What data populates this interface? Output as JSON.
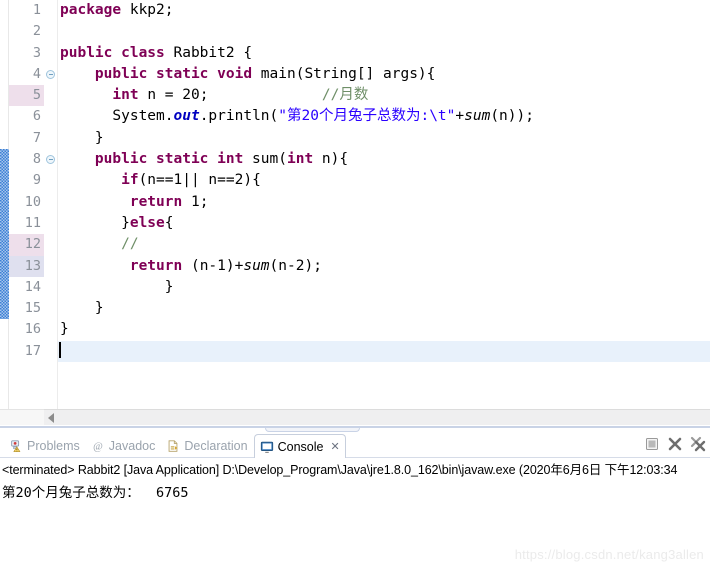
{
  "editor": {
    "total_lines": 17,
    "current_line": 17,
    "highlight_lines_pink": [
      5,
      12
    ],
    "highlight_lines_blue": [
      13
    ],
    "change_bar_lines": [
      8,
      9,
      10,
      11,
      12,
      13,
      14,
      15
    ],
    "fold_marker_lines": [
      4,
      8
    ],
    "lines": [
      {
        "num": "1",
        "tokens": [
          {
            "t": "kw",
            "v": "package"
          },
          {
            "t": "pln",
            "v": " kkp2;"
          }
        ]
      },
      {
        "num": "2",
        "tokens": []
      },
      {
        "num": "3",
        "tokens": [
          {
            "t": "kw",
            "v": "public class"
          },
          {
            "t": "pln",
            "v": " Rabbit2 {"
          }
        ]
      },
      {
        "num": "4",
        "tokens": [
          {
            "t": "pln",
            "v": "    "
          },
          {
            "t": "kw",
            "v": "public static void"
          },
          {
            "t": "pln",
            "v": " main(String[] args){"
          }
        ]
      },
      {
        "num": "5",
        "tokens": [
          {
            "t": "pln",
            "v": "      "
          },
          {
            "t": "kw",
            "v": "int"
          },
          {
            "t": "pln",
            "v": " n = 20;             "
          },
          {
            "t": "cmt",
            "v": "//月数"
          }
        ]
      },
      {
        "num": "6",
        "tokens": [
          {
            "t": "pln",
            "v": "      System."
          },
          {
            "t": "fld",
            "v": "out"
          },
          {
            "t": "pln",
            "v": ".println("
          },
          {
            "t": "str",
            "v": "\"第20个月兔子总数为:\\t\""
          },
          {
            "t": "pln",
            "v": "+"
          },
          {
            "t": "mth",
            "v": "sum"
          },
          {
            "t": "pln",
            "v": "(n));"
          }
        ]
      },
      {
        "num": "7",
        "tokens": [
          {
            "t": "pln",
            "v": "    }"
          }
        ]
      },
      {
        "num": "8",
        "tokens": [
          {
            "t": "pln",
            "v": "    "
          },
          {
            "t": "kw",
            "v": "public static int"
          },
          {
            "t": "pln",
            "v": " sum("
          },
          {
            "t": "kw",
            "v": "int"
          },
          {
            "t": "pln",
            "v": " n){"
          }
        ]
      },
      {
        "num": "9",
        "tokens": [
          {
            "t": "pln",
            "v": "       "
          },
          {
            "t": "kw",
            "v": "if"
          },
          {
            "t": "pln",
            "v": "(n==1|| n==2){"
          }
        ]
      },
      {
        "num": "10",
        "tokens": [
          {
            "t": "pln",
            "v": "        "
          },
          {
            "t": "kw",
            "v": "return"
          },
          {
            "t": "pln",
            "v": " 1;"
          }
        ]
      },
      {
        "num": "11",
        "tokens": [
          {
            "t": "pln",
            "v": "       }"
          },
          {
            "t": "kw",
            "v": "else"
          },
          {
            "t": "pln",
            "v": "{"
          }
        ]
      },
      {
        "num": "12",
        "tokens": [
          {
            "t": "pln",
            "v": "       "
          },
          {
            "t": "cmt",
            "v": "//"
          }
        ]
      },
      {
        "num": "13",
        "tokens": [
          {
            "t": "pln",
            "v": "        "
          },
          {
            "t": "kw",
            "v": "return"
          },
          {
            "t": "pln",
            "v": " (n-1)+"
          },
          {
            "t": "mth",
            "v": "sum"
          },
          {
            "t": "pln",
            "v": "(n-2);"
          }
        ]
      },
      {
        "num": "14",
        "tokens": [
          {
            "t": "pln",
            "v": "            }"
          }
        ]
      },
      {
        "num": "15",
        "tokens": [
          {
            "t": "pln",
            "v": "    }"
          }
        ]
      },
      {
        "num": "16",
        "tokens": [
          {
            "t": "pln",
            "v": "}"
          }
        ]
      },
      {
        "num": "17",
        "tokens": []
      }
    ],
    "scrollbar": {
      "h_left_arrow": "scroll-left-arrow"
    }
  },
  "bottom_panel": {
    "tabs": [
      {
        "label": "Problems",
        "icon": "problems-icon",
        "active": false,
        "closable": false
      },
      {
        "label": "Javadoc",
        "icon": "javadoc-icon",
        "active": false,
        "closable": false
      },
      {
        "label": "Declaration",
        "icon": "declaration-icon",
        "active": false,
        "closable": false
      },
      {
        "label": "Console",
        "icon": "console-icon",
        "active": true,
        "closable": true
      }
    ],
    "tab_close_glyph": "✕",
    "toolbar": [
      {
        "name": "terminate-button",
        "title": "Terminate"
      },
      {
        "name": "remove-launch-button",
        "title": "Remove Launch"
      },
      {
        "name": "remove-all-button",
        "title": "Remove All Terminated Launches"
      }
    ],
    "console": {
      "status_line": "<terminated> Rabbit2 [Java Application] D:\\Develop_Program\\Java\\jre1.8.0_162\\bin\\javaw.exe (2020年6月6日 下午12:03:34",
      "output": "第20个月兔子总数为：  6765"
    }
  },
  "watermark": {
    "text": "https://blog.csdn.net/kang3allen"
  },
  "colors": {
    "keyword": "#7f0055",
    "string": "#2a00ff",
    "comment": "#6f8f68",
    "field": "#0000c0",
    "current_line": "#e8f1fb",
    "change_bar": "#3b7fd4",
    "gutter_text": "#8a9099"
  }
}
